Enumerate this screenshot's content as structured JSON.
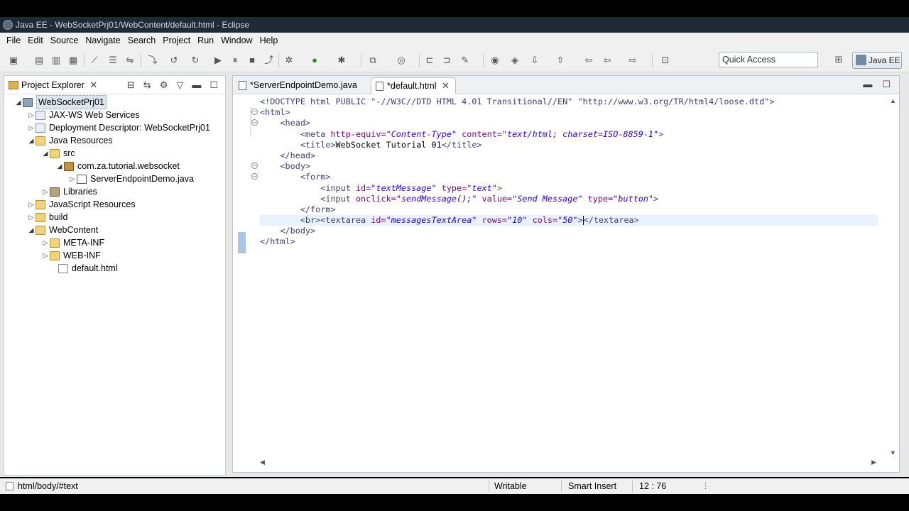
{
  "window": {
    "title": "Java EE - WebSocketPrj01/WebContent/default.html - Eclipse"
  },
  "menu": [
    "File",
    "Edit",
    "Source",
    "Navigate",
    "Search",
    "Project",
    "Run",
    "Window",
    "Help"
  ],
  "toolbar": {
    "quick_access": "Quick Access",
    "perspective": "Java EE"
  },
  "explorer": {
    "title": "Project Explorer",
    "close": "✕",
    "items": [
      {
        "label": "WebSocketPrj01",
        "icon": "project-icon",
        "expanded": true
      },
      {
        "label": "JAX-WS Web Services",
        "icon": "web-services-icon"
      },
      {
        "label": "Deployment Descriptor: WebSocketPrj01",
        "icon": "deployment-descriptor-icon"
      },
      {
        "label": "Java Resources",
        "icon": "java-resources-icon",
        "expanded": true
      },
      {
        "label": "src",
        "icon": "source-folder-icon",
        "expanded": true
      },
      {
        "label": "com.za.tutorial.websocket",
        "icon": "package-icon",
        "expanded": true
      },
      {
        "label": "ServerEndpointDemo.java",
        "icon": "java-file-icon"
      },
      {
        "label": "Libraries",
        "icon": "libraries-icon"
      },
      {
        "label": "JavaScript Resources",
        "icon": "javascript-resources-icon"
      },
      {
        "label": "build",
        "icon": "folder-icon"
      },
      {
        "label": "WebContent",
        "icon": "folder-icon",
        "expanded": true
      },
      {
        "label": "META-INF",
        "icon": "folder-icon"
      },
      {
        "label": "WEB-INF",
        "icon": "folder-icon"
      },
      {
        "label": "default.html",
        "icon": "html-file-icon"
      }
    ]
  },
  "editor": {
    "tabs": [
      {
        "label": "*ServerEndpointDemo.java",
        "active": false
      },
      {
        "label": "*default.html",
        "active": true
      }
    ],
    "tab_close": "✕",
    "code": {
      "l1": "<!DOCTYPE html PUBLIC \"-//W3C//DTD HTML 4.01 Transitional//EN\" \"http://www.w3.org/TR/html4/loose.dtd\">",
      "l2": "<html>",
      "l3": "<head>",
      "l4_tag": "<meta ",
      "l4_a1": "http-equiv=",
      "l4_v1": "\"Content-Type\"",
      "l4_a2": " content=",
      "l4_v2": "\"text/html; charset=ISO-8859-1\"",
      "l4_end": ">",
      "l5_open": "<title>",
      "l5_text": "WebSocket Tutorial 01",
      "l5_close": "</title>",
      "l6": "</head>",
      "l7": "<body>",
      "l8": "<form>",
      "l9_tag": "<input ",
      "l9_a1": "id=",
      "l9_v1": "\"textMessage\"",
      "l9_a2": " type=",
      "l9_v2": "\"text\"",
      "l9_end": ">",
      "l10_tag": "<input ",
      "l10_a1": "onclick=",
      "l10_v1": "\"sendMessage();\"",
      "l10_a2": " value=",
      "l10_v2": "\"Send Message\"",
      "l10_a3": " type=",
      "l10_v3": "\"button\"",
      "l10_end": ">",
      "l11": "</form>",
      "l12_tag": "<br><textarea ",
      "l12_a1": "id=",
      "l12_v1": "\"messagesTextArea\"",
      "l12_a2": " rows=",
      "l12_v2": "\"10\"",
      "l12_a3": " cols=",
      "l12_v3": "\"50\"",
      "l12_mid": ">",
      "l12_end": "</textarea>",
      "l13": "</body>",
      "l14": "</html>"
    }
  },
  "status": {
    "path": "html/body/#text",
    "writable": "Writable",
    "insert_mode": "Smart Insert",
    "position": "12 : 76"
  }
}
